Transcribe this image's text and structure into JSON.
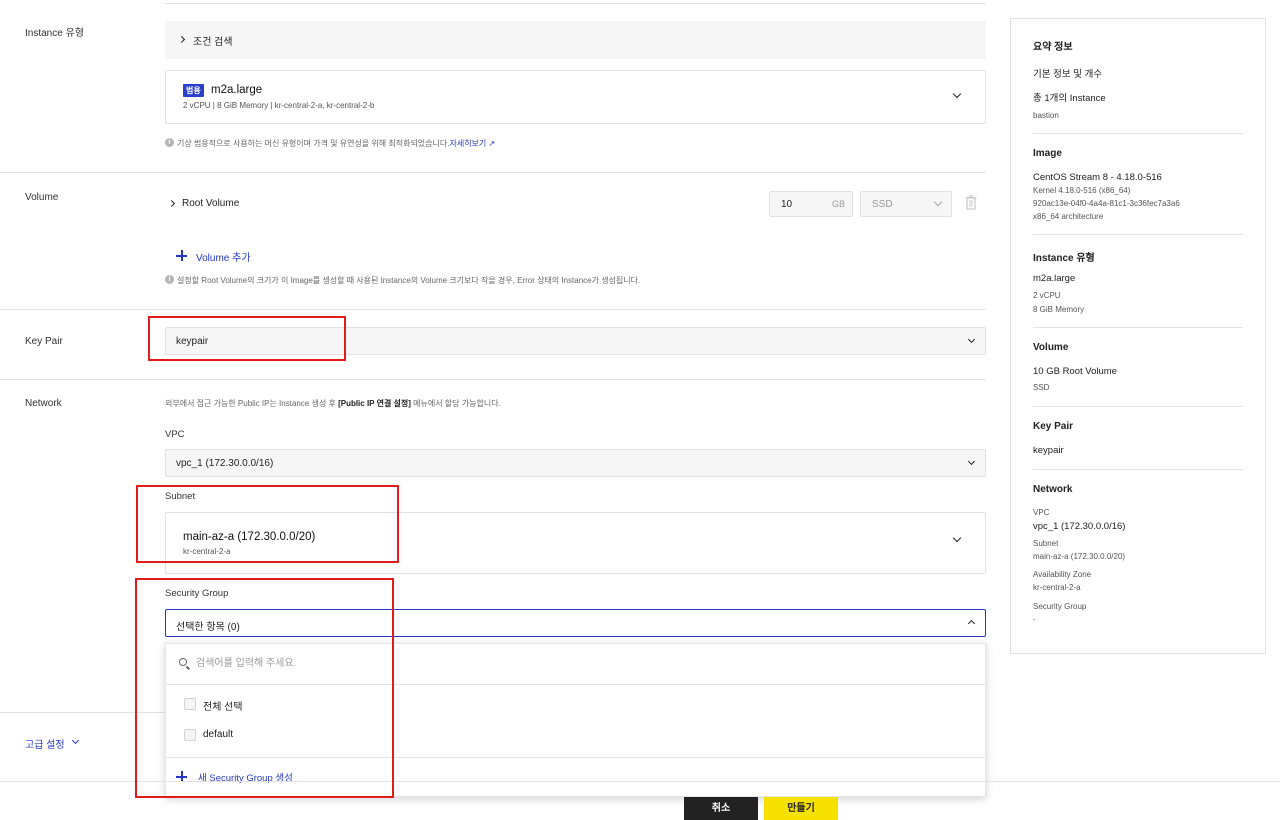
{
  "instance_type": {
    "section_label": "Instance 유형",
    "filter_label": "조건 검색",
    "badge": "범용",
    "selected_name": "m2a.large",
    "selected_detail": "2 vCPU | 8 GiB Memory | kr-central-2-a, kr-central-2-b",
    "note": "기상 범용적으로 사용하는 머신 유형이며 가격 및 유연성을 위해 최적화되었습니다.",
    "note_link": "자세히보기"
  },
  "volume": {
    "section_label": "Volume",
    "root_label": "Root Volume",
    "size_value": "10",
    "size_unit": "GB",
    "disk_type": "SSD",
    "add_label": "Volume 추가",
    "note": "설정할 Root Volume의 크기가 이 Image를 생성할 때 사용된 Instance의 Volume 크기보다 작을 경우, Error 상태의 Instance가 생성됩니다."
  },
  "key_pair": {
    "section_label": "Key Pair",
    "selected": "keypair"
  },
  "network": {
    "section_label": "Network",
    "note_prefix": "외부에서 접근 가능한 Public IP는 Instance 생성 후 ",
    "note_bold": "[Public IP 연결 설정]",
    "note_suffix": " 메뉴에서 할당 가능합니다.",
    "vpc_label": "VPC",
    "vpc_value": "vpc_1 (172.30.0.0/16)",
    "subnet_label": "Subnet",
    "subnet_value": "main-az-a (172.30.0.0/20)",
    "subnet_zone": "kr-central-2-a",
    "sg_label": "Security Group",
    "sg_selected": "선택한 항목 (0)",
    "sg_search_placeholder": "검색어를 입력해 주세요.",
    "sg_options": [
      "전체 선택",
      "default"
    ],
    "sg_create": "새 Security Group 생성"
  },
  "advanced": {
    "label": "고급 설정"
  },
  "summary": {
    "title": "요약 정보",
    "basic_label": "기본 정보 및 개수",
    "instance_count": "총 1개의 Instance",
    "instance_name": "bastion",
    "image_title": "Image",
    "image_name": "CentOS Stream 8 - 4.18.0-516",
    "image_kernel": "Kernel 4.18.0-516 (x86_64)",
    "image_id": "920ac13e-04f0-4a4a-81c1-3c36fec7a3a6",
    "image_arch": "x86_64 architecture",
    "type_title": "Instance 유형",
    "type_name": "m2a.large",
    "type_cpu": "2 vCPU",
    "type_mem": "8 GiB Memory",
    "volume_title": "Volume",
    "volume_value": "10 GB Root Volume",
    "volume_type": "SSD",
    "keypair_title": "Key Pair",
    "keypair_value": "keypair",
    "network_title": "Network",
    "vpc_label": "VPC",
    "vpc_value": "vpc_1 (172.30.0.0/16)",
    "subnet_label": "Subnet",
    "subnet_value": "main-az-a (172.30.0.0/20)",
    "az_label": "Availability Zone",
    "az_value": "kr-central-2-a",
    "sg_label": "Security Group",
    "sg_value": "-"
  },
  "footer": {
    "cancel_label": "취소",
    "create_label": "만들기"
  },
  "colors": {
    "accent_blue": "#2437c4",
    "badge_blue": "#2a3fc9",
    "create_yellow": "#f5e000",
    "cancel_black": "#222222",
    "highlight_red": "#e21b1b"
  }
}
